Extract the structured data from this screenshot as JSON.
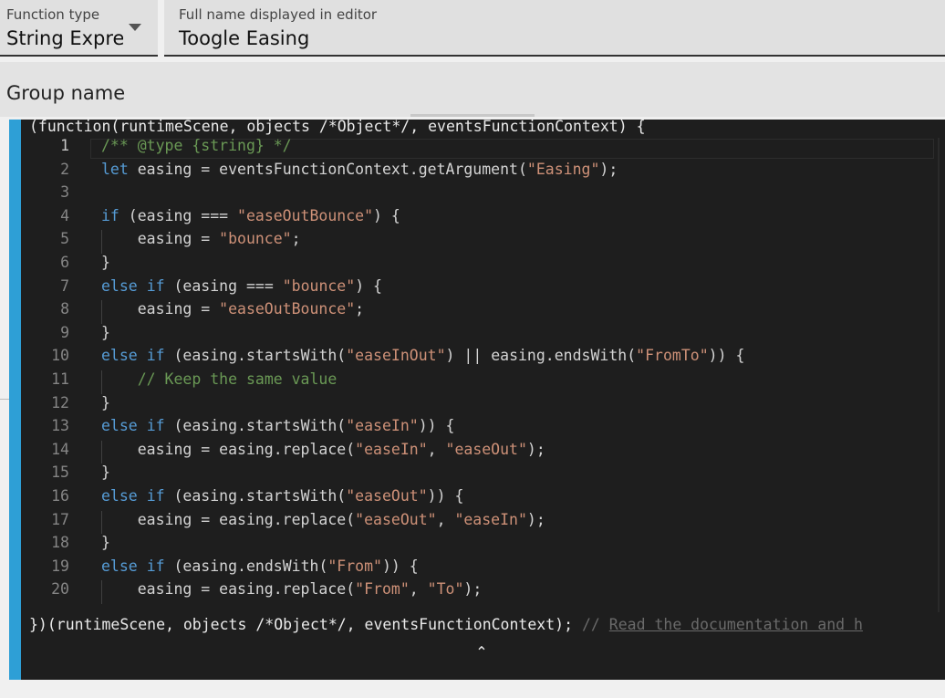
{
  "function_type": {
    "label": "Function type",
    "value": "String Expres"
  },
  "full_name": {
    "label": "Full name displayed in editor",
    "value": "Toogle Easing"
  },
  "group_name": {
    "label": "Group name"
  },
  "editor": {
    "header": "(function(runtimeScene, objects /*Object*/, eventsFunctionContext) {",
    "footer_code": "})(runtimeScene, objects /*Object*/, eventsFunctionContext); ",
    "footer_comment": "// ",
    "footer_link": "Read the documentation and h",
    "line_numbers": [
      "1",
      "2",
      "3",
      "4",
      "5",
      "6",
      "7",
      "8",
      "9",
      "10",
      "11",
      "12",
      "13",
      "14",
      "15",
      "16",
      "17",
      "18",
      "19",
      "20"
    ],
    "lines": [
      "/** @type {string} */",
      "let easing = eventsFunctionContext.getArgument(\"Easing\");",
      "",
      "if (easing === \"easeOutBounce\") {",
      "    easing = \"bounce\";",
      "}",
      "else if (easing === \"bounce\") {",
      "    easing = \"easeOutBounce\";",
      "}",
      "else if (easing.startsWith(\"easeInOut\") || easing.endsWith(\"FromTo\")) {",
      "    // Keep the same value",
      "}",
      "else if (easing.startsWith(\"easeIn\")) {",
      "    easing = easing.replace(\"easeIn\", \"easeOut\");",
      "}",
      "else if (easing.startsWith(\"easeOut\")) {",
      "    easing = easing.replace(\"easeOut\", \"easeIn\");",
      "}",
      "else if (easing.endsWith(\"From\")) {",
      "    easing = easing.replace(\"From\", \"To\");"
    ],
    "active_line": 1,
    "colors": {
      "background": "#1e1e1e",
      "accent_bar": "#2e9fd6",
      "keyword": "#569cd6",
      "string": "#ce9178",
      "comment": "#6a9955"
    }
  },
  "icons": {
    "dropdown": "chevron-down-icon",
    "collapse": "chevron-up-icon"
  }
}
